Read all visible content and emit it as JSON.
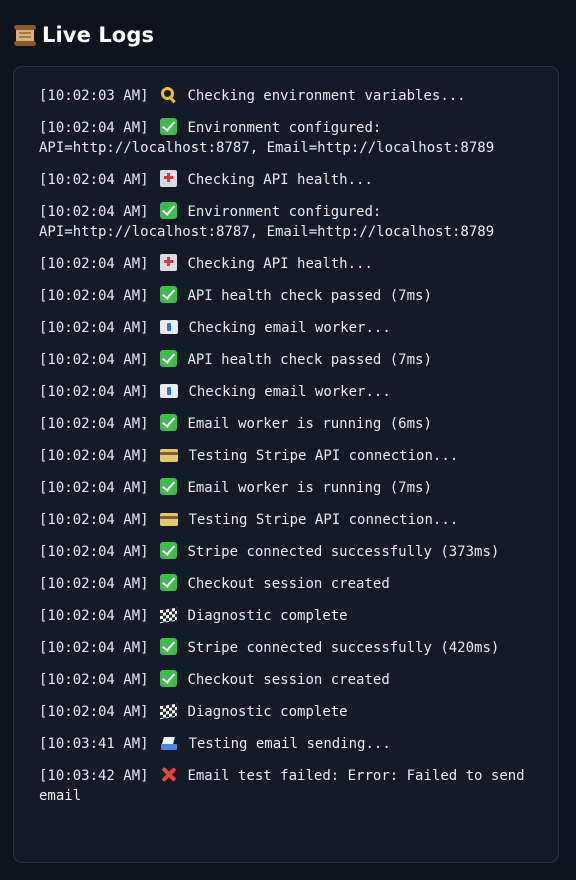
{
  "header": {
    "icon": "scroll-icon",
    "title": "Live Logs"
  },
  "logs": [
    {
      "timestamp": "[10:02:03 AM]",
      "icon": "key-icon",
      "message": "Checking environment variables..."
    },
    {
      "timestamp": "[10:02:04 AM]",
      "icon": "check-icon",
      "message": "Environment configured: API=http://localhost:8787, Email=http://localhost:8789"
    },
    {
      "timestamp": "[10:02:04 AM]",
      "icon": "hospital-icon",
      "message": "Checking API health..."
    },
    {
      "timestamp": "[10:02:04 AM]",
      "icon": "check-icon",
      "message": "Environment configured: API=http://localhost:8787, Email=http://localhost:8789"
    },
    {
      "timestamp": "[10:02:04 AM]",
      "icon": "hospital-icon",
      "message": "Checking API health..."
    },
    {
      "timestamp": "[10:02:04 AM]",
      "icon": "check-icon",
      "message": "API health check passed (7ms)"
    },
    {
      "timestamp": "[10:02:04 AM]",
      "icon": "email-icon",
      "message": "Checking email worker..."
    },
    {
      "timestamp": "[10:02:04 AM]",
      "icon": "check-icon",
      "message": "API health check passed (7ms)"
    },
    {
      "timestamp": "[10:02:04 AM]",
      "icon": "email-icon",
      "message": "Checking email worker..."
    },
    {
      "timestamp": "[10:02:04 AM]",
      "icon": "check-icon",
      "message": "Email worker is running (6ms)"
    },
    {
      "timestamp": "[10:02:04 AM]",
      "icon": "credit-card-icon",
      "message": "Testing Stripe API connection..."
    },
    {
      "timestamp": "[10:02:04 AM]",
      "icon": "check-icon",
      "message": "Email worker is running (7ms)"
    },
    {
      "timestamp": "[10:02:04 AM]",
      "icon": "credit-card-icon",
      "message": "Testing Stripe API connection..."
    },
    {
      "timestamp": "[10:02:04 AM]",
      "icon": "check-icon",
      "message": "Stripe connected successfully (373ms)"
    },
    {
      "timestamp": "[10:02:04 AM]",
      "icon": "check-icon",
      "message": "Checkout session created"
    },
    {
      "timestamp": "[10:02:04 AM]",
      "icon": "checkered-flag-icon",
      "message": "Diagnostic complete"
    },
    {
      "timestamp": "[10:02:04 AM]",
      "icon": "check-icon",
      "message": "Stripe connected successfully (420ms)"
    },
    {
      "timestamp": "[10:02:04 AM]",
      "icon": "check-icon",
      "message": "Checkout session created"
    },
    {
      "timestamp": "[10:02:04 AM]",
      "icon": "checkered-flag-icon",
      "message": "Diagnostic complete"
    },
    {
      "timestamp": "[10:03:41 AM]",
      "icon": "email-sending-icon",
      "message": "Testing email sending..."
    },
    {
      "timestamp": "[10:03:42 AM]",
      "icon": "cross-icon",
      "message": "Email test failed: Error: Failed to send email"
    }
  ]
}
